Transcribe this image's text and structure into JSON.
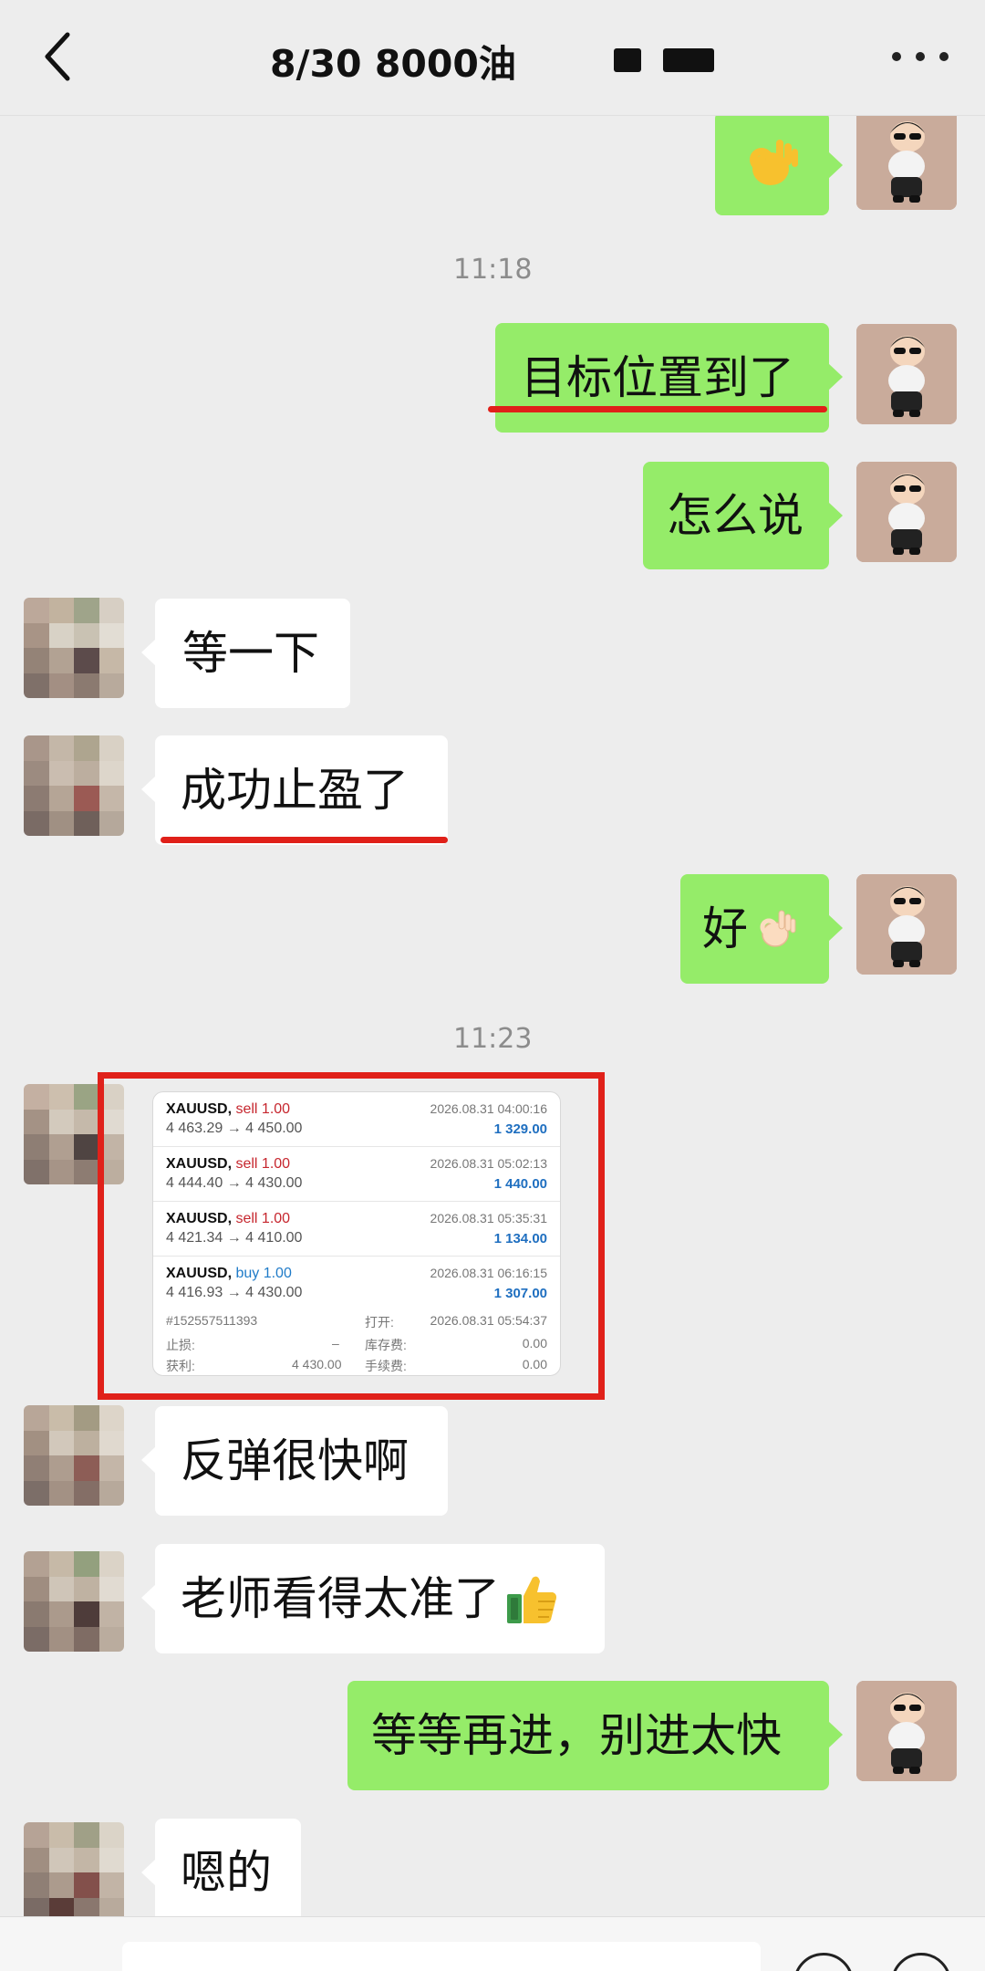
{
  "header": {
    "title": "8/30  8000油",
    "back_icon": "chevron-left-icon",
    "more_icon": "more-dots-icon"
  },
  "timestamps": [
    "11:18",
    "11:23"
  ],
  "messages": [
    {
      "side": "me",
      "text": "",
      "emoji": "ok-hand"
    },
    {
      "side": "me",
      "text": "目标位置到了",
      "underlined": true
    },
    {
      "side": "me",
      "text": "怎么说"
    },
    {
      "side": "other",
      "text": "等一下"
    },
    {
      "side": "other",
      "text": "成功止盈了",
      "underlined": true
    },
    {
      "side": "me",
      "text": "好",
      "emoji": "ok-hand"
    },
    {
      "side": "other",
      "text": "反弹很快啊"
    },
    {
      "side": "other",
      "text": "老师看得太准了",
      "emoji": "thumbs-up"
    },
    {
      "side": "me",
      "text": "等等再进，别进太快"
    },
    {
      "side": "other",
      "text": "嗯的"
    }
  ],
  "trade_card": {
    "rows": [
      {
        "symbol": "XAUUSD,",
        "side": "sell 1.00",
        "prices": "4 463.29 → 4 450.00",
        "time": "2026.08.31 04:00:16",
        "profit": "1 329.00"
      },
      {
        "symbol": "XAUUSD,",
        "side": "sell 1.00",
        "prices": "4 444.40 → 4 430.00",
        "time": "2026.08.31 05:02:13",
        "profit": "1 440.00"
      },
      {
        "symbol": "XAUUSD,",
        "side": "sell 1.00",
        "prices": "4 421.34 → 4 410.00",
        "time": "2026.08.31 05:35:31",
        "profit": "1 134.00"
      },
      {
        "symbol": "XAUUSD,",
        "side": "buy 1.00",
        "prices": "4 416.93 → 4 430.00",
        "time": "2026.08.31 06:16:15",
        "profit": "1 307.00"
      }
    ],
    "details": {
      "order_id": "#152557511393",
      "open_label": "打开:",
      "open_time": "2026.08.31 05:54:37",
      "sl_label": "止损:",
      "sl_value": "–",
      "swap_label": "库存费:",
      "swap_value": "0.00",
      "tp_label": "获利:",
      "tp_value": "4 430.00",
      "fee_label": "手续费:",
      "fee_value": "0.00"
    }
  },
  "colors": {
    "bubble_me": "#95ec69",
    "bubble_other": "#ffffff",
    "highlight": "#e0211a",
    "background": "#ededed"
  }
}
